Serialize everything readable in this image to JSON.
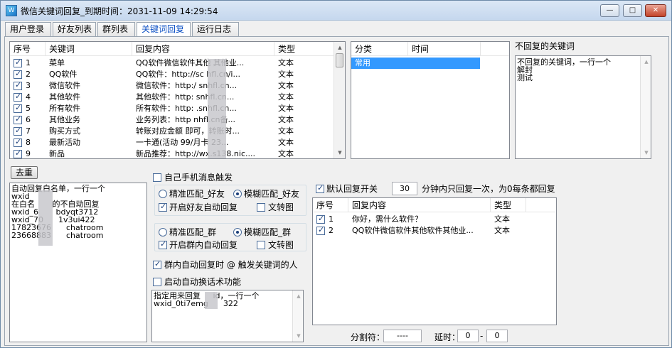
{
  "window": {
    "title": "微信关键词回复_到期时间：2031-11-09 14:29:54",
    "app_icon": "app-icon",
    "min_label": "—",
    "max_label": "□",
    "close_label": "✕"
  },
  "tabs": [
    {
      "label": "用户登录"
    },
    {
      "label": "好友列表"
    },
    {
      "label": "群列表"
    },
    {
      "label": "关键词回复"
    },
    {
      "label": "运行日志"
    }
  ],
  "keyword_table": {
    "headers": [
      "序号",
      "关键词",
      "回复内容",
      "类型"
    ],
    "rows": [
      {
        "checked": true,
        "num": "1",
        "keyword": "菜单",
        "reply": "QQ软件微信软件其他   其他业...",
        "type": "文本"
      },
      {
        "checked": true,
        "num": "2",
        "keyword": "QQ软件",
        "reply": "QQ软件：http://sc    hfl.cn/i...",
        "type": "文本"
      },
      {
        "checked": true,
        "num": "3",
        "keyword": "微信软件",
        "reply": "微信软件：http:/     snhfl.cn...",
        "type": "文本"
      },
      {
        "checked": true,
        "num": "4",
        "keyword": "其他软件",
        "reply": "其他软件：http:     snhfl.cn...",
        "type": "文本"
      },
      {
        "checked": true,
        "num": "5",
        "keyword": "所有软件",
        "reply": "所有软件：http:     .snhfl.cn...",
        "type": "文本"
      },
      {
        "checked": true,
        "num": "6",
        "keyword": "其他业务",
        "reply": "业务列表：http     nhfl.cn备...",
        "type": "文本"
      },
      {
        "checked": true,
        "num": "7",
        "keyword": "购买方式",
        "reply": "转账对应金额    即可，转账时...",
        "type": "文本"
      },
      {
        "checked": true,
        "num": "8",
        "keyword": "最新活动",
        "reply": "一卡通(活动    99/月卡     23...",
        "type": "文本"
      },
      {
        "checked": true,
        "num": "9",
        "keyword": "新品",
        "reply": "新品推荐：http://wx.s138.nic....",
        "type": "文本"
      }
    ]
  },
  "category_table": {
    "headers": [
      "分类",
      "时间"
    ],
    "rows": [
      {
        "category": "常用",
        "time": ""
      }
    ]
  },
  "no_reply": {
    "label": "不回复的关键词",
    "text": "不回复的关键词，一行一个\n解封\n测试"
  },
  "dedupe_button": "去重",
  "whitelist": {
    "text": "自动回复白名单，一行一个\nwxid_\n在白名       的不自动回复\nwxid_6       bdyqt3712\nwxid_70      1v3ui422\n17823676      chatroom\n23668883      chatroom"
  },
  "options": {
    "self_trigger": {
      "label": "自己手机消息触发",
      "checked": false
    },
    "friend_exact": {
      "label": "精准匹配_好友",
      "selected": false
    },
    "friend_fuzzy": {
      "label": "模糊匹配_好友",
      "selected": true
    },
    "friend_auto": {
      "label": "开启好友自动回复",
      "checked": true
    },
    "friend_img": {
      "label": "文转图",
      "checked": false
    },
    "group_exact": {
      "label": "精准匹配_群",
      "selected": false
    },
    "group_fuzzy": {
      "label": "模糊匹配_群",
      "selected": true
    },
    "group_auto": {
      "label": "开启群内自动回复",
      "checked": true
    },
    "group_img": {
      "label": "文转图",
      "checked": false
    },
    "group_at": {
      "label": "群内自动回复时 @ 触发关键词的人",
      "checked": true
    },
    "auto_script": {
      "label": "启动自动换话术功能",
      "checked": false
    }
  },
  "assign_reply": {
    "text": "指定用来回复     id，一行一个\nwxid_0ti7emg      322"
  },
  "default_reply": {
    "label": "默认回复开关",
    "checked": true,
    "minutes": "30",
    "suffix": "分钟内只回复一次，为0每条都回复"
  },
  "default_table": {
    "headers": [
      "序号",
      "回复内容",
      "类型"
    ],
    "rows": [
      {
        "checked": true,
        "num": "1",
        "content": "你好，需什么软件？",
        "type": "文本"
      },
      {
        "checked": true,
        "num": "2",
        "content": "QQ软件微信软件其他软件其他业...",
        "type": "文本"
      }
    ]
  },
  "bottom": {
    "separator_label": "分割符：",
    "separator_value": "----",
    "delay_label": "延时：",
    "delay_min": "0",
    "dash": "-",
    "delay_max": "0"
  }
}
